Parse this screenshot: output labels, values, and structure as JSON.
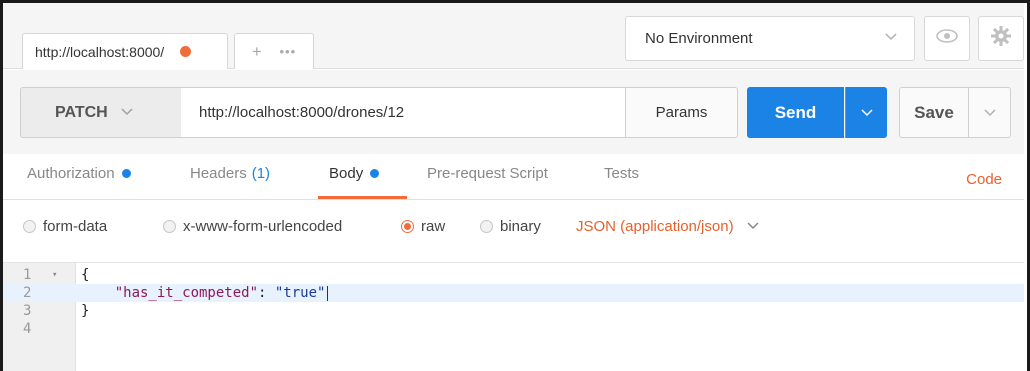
{
  "tabbar": {
    "tab_title": "http://localhost:8000/",
    "new_tab": "+",
    "more": "•••"
  },
  "environment": {
    "selected": "No Environment"
  },
  "request": {
    "method": "PATCH",
    "url": "http://localhost:8000/drones/12",
    "params_label": "Params",
    "send_label": "Send",
    "save_label": "Save"
  },
  "request_tabs": {
    "authorization": "Authorization",
    "headers": "Headers",
    "headers_count": "(1)",
    "body": "Body",
    "pre_request": "Pre-request Script",
    "tests": "Tests",
    "code": "Code"
  },
  "body_types": {
    "form_data": "form-data",
    "urlencoded": "x-www-form-urlencoded",
    "raw": "raw",
    "binary": "binary",
    "selected": "raw",
    "content_type": "JSON (application/json)"
  },
  "editor": {
    "line_numbers": [
      "1",
      "2",
      "3",
      "4"
    ],
    "active_line": 2,
    "line1": "{",
    "line2_indent": "    ",
    "line2_key": "\"has_it_competed\"",
    "line2_colon": ": ",
    "line2_value": "\"true\"",
    "line3": "}"
  },
  "colors": {
    "accent_orange": "#f26b3a",
    "send_blue": "#1b83e6",
    "indicator_blue": "#1b83e6"
  }
}
